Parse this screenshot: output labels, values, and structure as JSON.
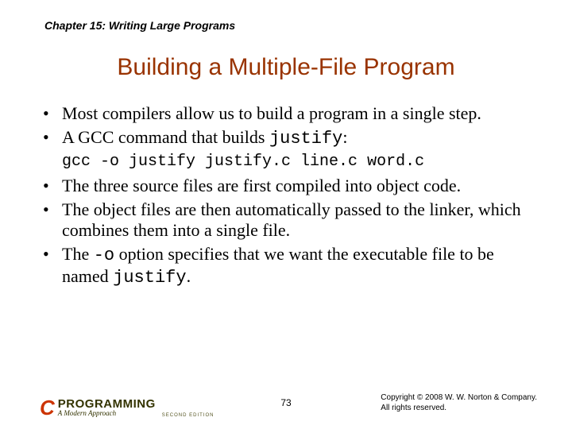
{
  "chapter_label": "Chapter 15: Writing Large Programs",
  "title": "Building a Multiple-File Program",
  "bullets": [
    {
      "pre": "Most compilers allow us to build a program in a single step."
    },
    {
      "pre": "A GCC command that builds ",
      "code": "justify",
      "post": ":"
    },
    {
      "code_line": "gcc -o justify justify.c line.c word.c"
    },
    {
      "pre": "The three source files are first compiled into object code."
    },
    {
      "pre": "The object files are then automatically passed to the linker, which combines them into a single file."
    },
    {
      "pre": "The ",
      "code": "-o",
      "mid": " option specifies that we want the executable file to be named ",
      "code2": "justify",
      "post": "."
    }
  ],
  "logo": {
    "c": "C",
    "prog": "PROGRAMMING",
    "sub": "A Modern Approach",
    "edition": "SECOND EDITION"
  },
  "page_number": "73",
  "copyright_line1": "Copyright © 2008 W. W. Norton & Company.",
  "copyright_line2": "All rights reserved."
}
